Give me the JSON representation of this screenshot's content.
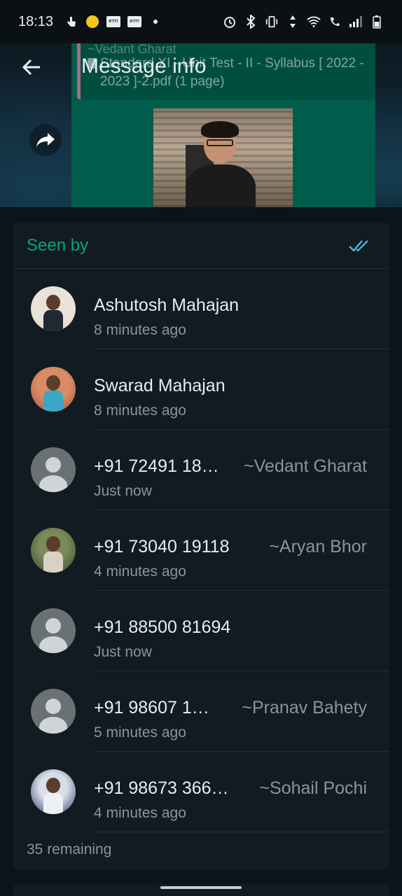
{
  "status_bar": {
    "time": "18:13",
    "icons_left": [
      "gesture-icon",
      "emoji-app-icon",
      "ifttt-icon",
      "ifttt-icon",
      "dot-icon"
    ],
    "icons_right": [
      "alarm-icon",
      "bluetooth-icon",
      "vibrate-icon",
      "data-icon",
      "wifi-icon",
      "wifi-calling-icon",
      "signal-icon",
      "battery-icon"
    ]
  },
  "header": {
    "title": "Message info",
    "back_icon": "arrow-back-icon",
    "forward_icon": "forward-icon"
  },
  "message": {
    "quoted_title": "~Vedant Gharat",
    "quoted_doc": "Standard XI - Unit Test - II - Syllabus [ 2022 - 2023 ]-2.pdf (1 page)"
  },
  "seen": {
    "label": "Seen by",
    "tick_color": "#53bdeb",
    "accent": "#00a884",
    "people": [
      {
        "name": "Ashutosh Mahajan",
        "pushname": "",
        "time": "8 minutes ago",
        "avatar": "photo"
      },
      {
        "name": "Swarad Mahajan",
        "pushname": "",
        "time": "8 minutes ago",
        "avatar": "photo"
      },
      {
        "name": "+91 72491 18…",
        "pushname": "~Vedant Gharat",
        "time": "Just now",
        "avatar": "default"
      },
      {
        "name": "+91 73040 19118",
        "pushname": "~Aryan Bhor",
        "time": "4 minutes ago",
        "avatar": "photo"
      },
      {
        "name": "+91 88500 81694",
        "pushname": "",
        "time": "Just now",
        "avatar": "default"
      },
      {
        "name": "+91 98607 1…",
        "pushname": "~Pranav Bahety",
        "time": "5 minutes ago",
        "avatar": "default"
      },
      {
        "name": "+91 98673 366…",
        "pushname": "~Sohail Pochi",
        "time": "4 minutes ago",
        "avatar": "photo"
      }
    ],
    "remaining": "35 remaining"
  }
}
